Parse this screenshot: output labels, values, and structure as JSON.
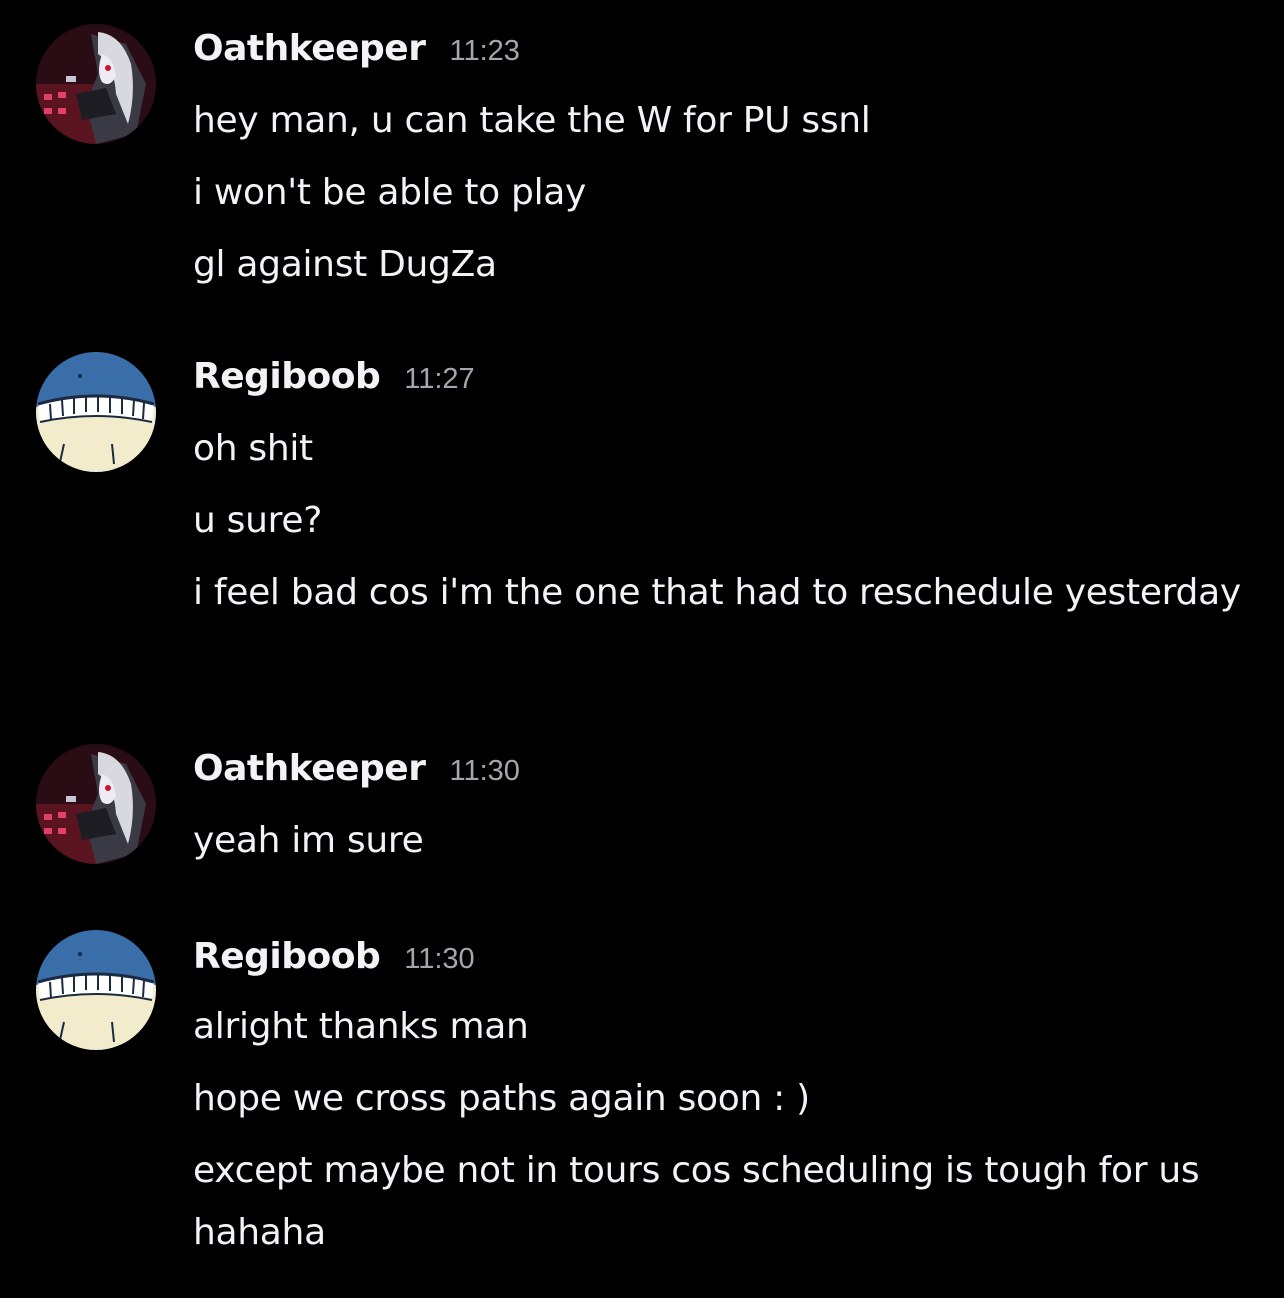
{
  "messages": [
    {
      "author": "Oathkeeper",
      "time": "11:23",
      "avatar_icon": "oathkeeper-avatar",
      "lines": [
        "hey man, u can take the W for PU ssnl",
        "i won't be able to play",
        "gl against DugZa"
      ]
    },
    {
      "author": "Regiboob",
      "time": "11:27",
      "avatar_icon": "wailord-avatar",
      "lines": [
        "oh shit",
        "u sure?",
        "i feel bad cos i'm the one that had to reschedule yesterday"
      ]
    },
    {
      "author": "Oathkeeper",
      "time": "11:30",
      "avatar_icon": "oathkeeper-avatar",
      "lines": [
        "yeah im sure"
      ]
    },
    {
      "author": "Regiboob",
      "time": "11:30",
      "avatar_icon": "wailord-avatar",
      "lines": [
        "alright thanks man",
        "hope we cross paths again soon : )",
        "except maybe not in tours cos scheduling is tough for us hahaha"
      ]
    }
  ],
  "colors": {
    "background": "#000000",
    "text": "#f2f3f5",
    "timestamp": "#a3a6ad"
  }
}
